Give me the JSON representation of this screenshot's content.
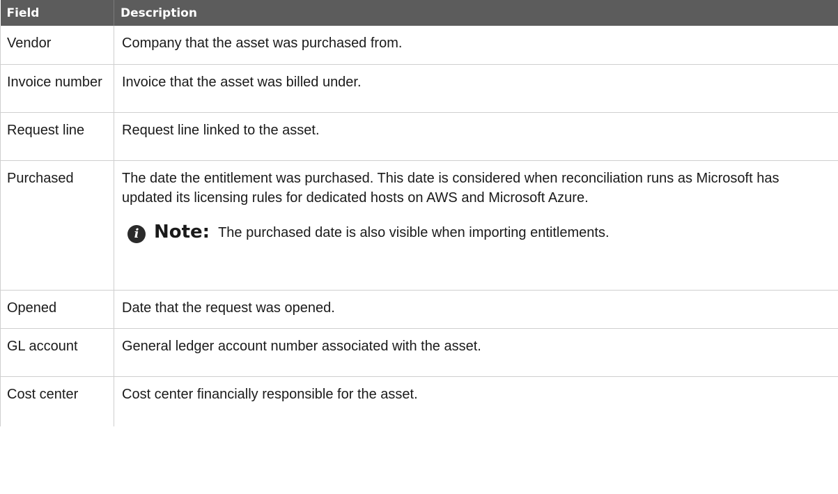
{
  "table": {
    "headers": [
      "Field",
      "Description"
    ],
    "rows": [
      {
        "field": "Vendor",
        "description": "Company that the asset was purchased from."
      },
      {
        "field": "Invoice number",
        "description": "Invoice that the asset was billed under."
      },
      {
        "field": "Request line",
        "description": "Request line linked to the asset."
      },
      {
        "field": "Purchased",
        "description": "The date the entitlement was purchased. This date is considered when reconciliation runs as Microsoft has updated its licensing rules for dedicated hosts on AWS and Microsoft Azure.",
        "note": {
          "icon": "info-icon",
          "label": "Note:",
          "text": "The purchased date is also visible when importing entitlements."
        }
      },
      {
        "field": "Opened",
        "description": "Date that the request was opened."
      },
      {
        "field": "GL account",
        "description": "General ledger account number associated with the asset."
      },
      {
        "field": "Cost center",
        "description": "Cost center financially responsible for the asset."
      }
    ]
  },
  "colors": {
    "header_bg": "#5c5c5c",
    "header_text": "#ffffff",
    "border": "#cfcfcf"
  }
}
